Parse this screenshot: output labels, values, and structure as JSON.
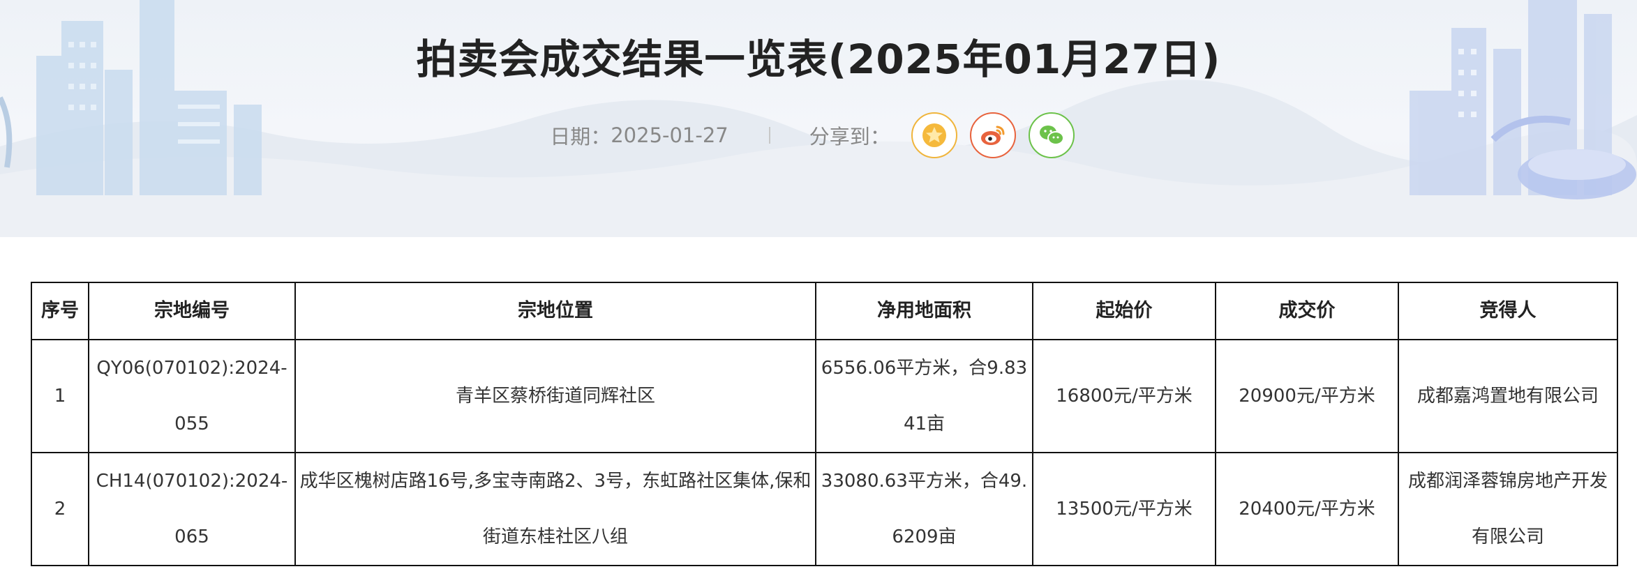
{
  "page": {
    "title": "拍卖会成交结果一览表(2025年01月27日)",
    "date_label": "日期：",
    "date_value": "2025-01-27",
    "share_label": "分享到："
  },
  "share_icons": [
    {
      "name": "favorite-star-icon",
      "color": "#f0b53c"
    },
    {
      "name": "weibo-icon",
      "color": "#e8633d"
    },
    {
      "name": "wechat-icon",
      "color": "#6cc24a"
    }
  ],
  "table": {
    "headers": [
      "序号",
      "宗地编号",
      "宗地位置",
      "净用地面积",
      "起始价",
      "成交价",
      "竞得人"
    ],
    "rows": [
      [
        "1",
        "QY06(070102):2024-055",
        "青羊区蔡桥街道同辉社区",
        "6556.06平方米，合9.8341亩",
        "16800元/平方米",
        "20900元/平方米",
        "成都嘉鸿置地有限公司"
      ],
      [
        "2",
        "CH14(070102):2024-065",
        "成华区槐树店路16号,多宝寺南路2、3号，东虹路社区集体,保和街道东桂社区八组",
        "33080.63平方米，合49.6209亩",
        "13500元/平方米",
        "20400元/平方米",
        "成都润泽蓉锦房地产开发有限公司"
      ]
    ]
  }
}
